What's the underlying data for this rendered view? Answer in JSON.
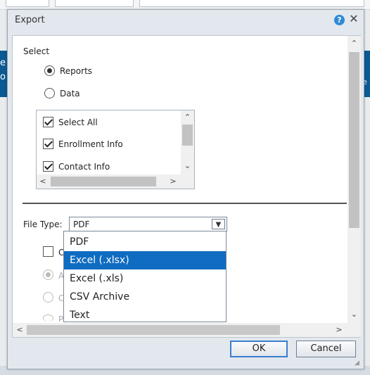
{
  "background": {
    "left_fragment": "e\no",
    "right_fragment": "e"
  },
  "dialog": {
    "title": "Export",
    "help_glyph": "?",
    "close_glyph": "✕"
  },
  "select_section": {
    "label": "Select",
    "options": [
      {
        "label": "Reports",
        "selected": true
      },
      {
        "label": "Data",
        "selected": false
      }
    ],
    "list_items": [
      {
        "label": "Select All",
        "checked": true
      },
      {
        "label": "Enrollment Info",
        "checked": true
      },
      {
        "label": "Contact Info",
        "checked": true
      }
    ]
  },
  "file_type": {
    "label": "File Type:",
    "value": "PDF",
    "options": [
      "PDF",
      "Excel (.xlsx)",
      "Excel (.xls)",
      "CSV Archive",
      "Text"
    ],
    "highlighted": "Excel (.xlsx)"
  },
  "hidden_options": {
    "checkbox_fragment": "Cu",
    "radio_fragments": [
      "All",
      "Cu",
      "Pa"
    ]
  },
  "buttons": {
    "ok": "OK",
    "cancel": "Cancel"
  },
  "colors": {
    "highlight": "#0f6cc1",
    "app_bar": "#0b5a93",
    "help_icon": "#2f8ad6"
  }
}
